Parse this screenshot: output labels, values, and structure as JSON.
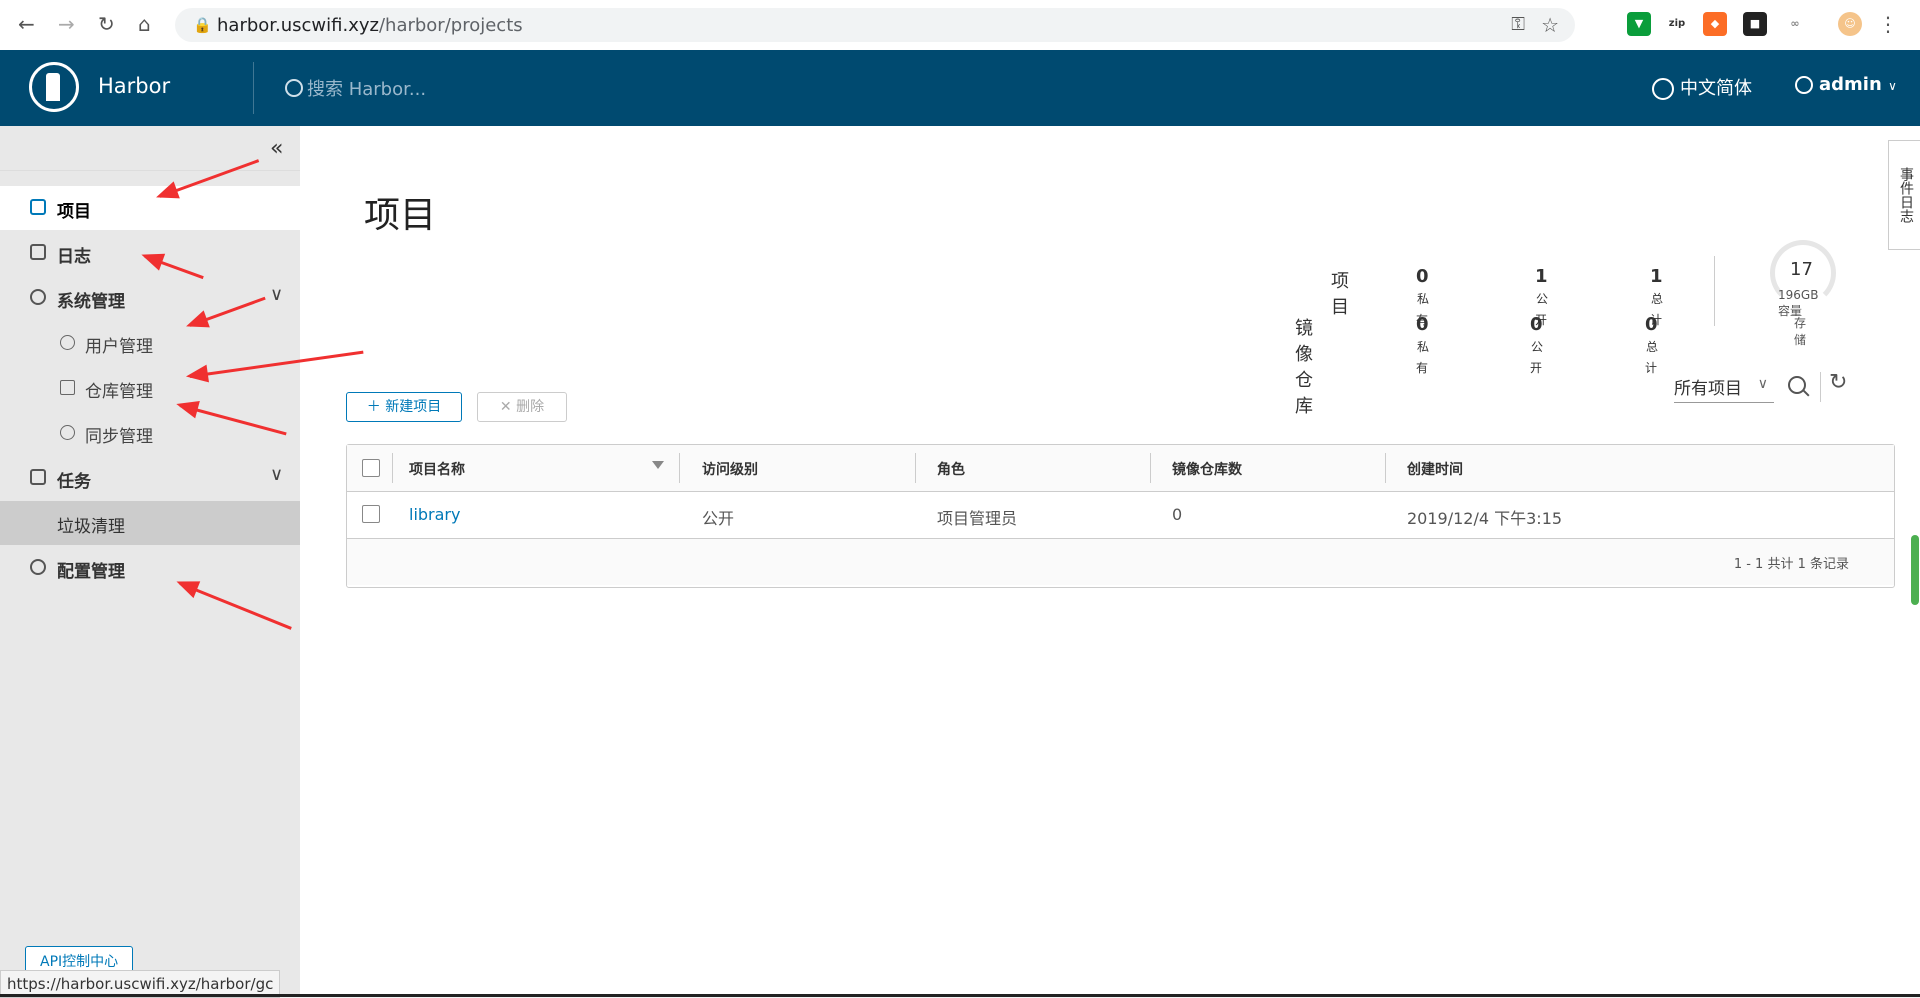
{
  "browser": {
    "url_host": "harbor.uscwifi.xyz",
    "url_path": "/harbor/projects",
    "status_url": "https://harbor.uscwifi.xyz/harbor/gc"
  },
  "header": {
    "brand": "Harbor",
    "search_placeholder": "搜索 Harbor...",
    "language": "中文简体",
    "user": "admin"
  },
  "sidebar": {
    "items": [
      {
        "label": "项目"
      },
      {
        "label": "日志"
      },
      {
        "label": "系统管理"
      },
      {
        "label": "用户管理"
      },
      {
        "label": "仓库管理"
      },
      {
        "label": "同步管理"
      },
      {
        "label": "任务"
      },
      {
        "label": "垃圾清理"
      },
      {
        "label": "配置管理"
      }
    ],
    "api_button": "API控制中心"
  },
  "main": {
    "title": "项目",
    "stats": {
      "projects_label": "项目",
      "repos_label": "镜像仓库",
      "private_label": "私有",
      "public_label": "公开",
      "total_label": "总计",
      "projects_private": "0",
      "projects_public": "1",
      "projects_total": "1",
      "repos_private": "0",
      "repos_public": "0",
      "repos_total": "0",
      "storage_value": "17",
      "storage_capacity": "196GB容量",
      "storage_label": "存储"
    },
    "new_project": "新建项目",
    "delete": "删除",
    "filter": "所有项目",
    "table": {
      "columns": [
        "项目名称",
        "访问级别",
        "角色",
        "镜像仓库数",
        "创建时间"
      ],
      "rows": [
        {
          "name": "library",
          "access": "公开",
          "role": "项目管理员",
          "repos": "0",
          "created": "2019/12/4 下午3:15"
        }
      ],
      "pagination": "1 - 1 共计 1 条记录"
    },
    "right_tab": "事件日志"
  },
  "colors": {
    "header_bg": "#004a70",
    "accent": "#0079b8",
    "annotation": "#f03030"
  }
}
